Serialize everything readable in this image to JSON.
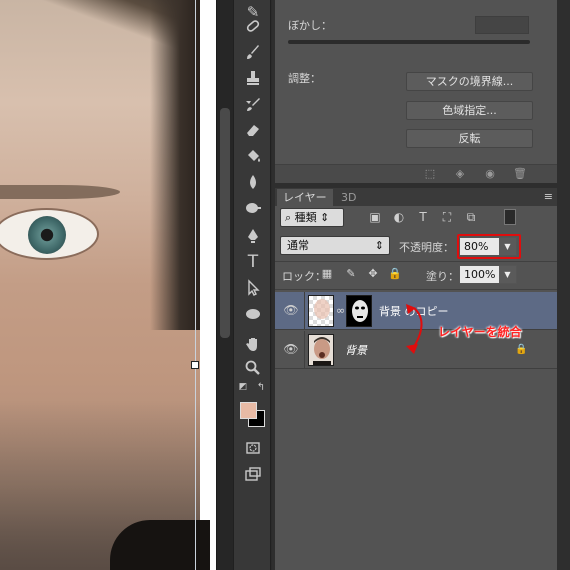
{
  "properties": {
    "blur_label": "ぼかし：",
    "adjust_label": "調整：",
    "buttons": [
      "マスクの境界線...",
      "色域指定...",
      "反転"
    ]
  },
  "layers_panel": {
    "tabs": [
      "レイヤー",
      "3D"
    ],
    "filter_label": "種類",
    "blend_mode": "通常",
    "opacity_label": "不透明度：",
    "opacity_value": "80%",
    "lock_label": "ロック：",
    "fill_label": "塗り：",
    "fill_value": "100%",
    "layers": [
      {
        "name": "背景 のコピー",
        "selected": true
      },
      {
        "name": "背景",
        "selected": false,
        "locked": true
      }
    ]
  },
  "annotation": "レイヤーを統合",
  "colors": {
    "foreground": "#e7baa5",
    "background": "#000000",
    "highlight": "#e00d0d",
    "selected_row": "#5d6a85"
  },
  "icons": [
    "brush-icon",
    "stamp-icon",
    "eraser-icon",
    "paint-bucket-icon",
    "drop-icon",
    "pen-icon",
    "type-icon",
    "select-arrow-icon",
    "ellipse-icon",
    "hand-icon",
    "zoom-icon",
    "eye-icon",
    "lock-icon",
    "link-icon"
  ]
}
